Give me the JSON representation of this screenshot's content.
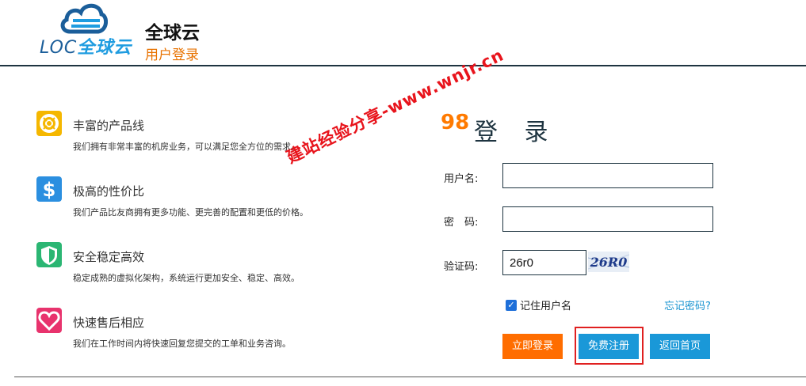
{
  "header": {
    "logo_loc": "LOC",
    "logo_cn": "全球云",
    "site_title": "全球云",
    "site_subtitle": "用户登录"
  },
  "features": [
    {
      "title": "丰富的产品线",
      "desc": "我们拥有非常丰富的机房业务，可以满足您全方位的需求。",
      "icon": "lifebuoy-icon",
      "color": "#f5b700"
    },
    {
      "title": "极高的性价比",
      "desc": "我们产品比友商拥有更多功能、更完善的配置和更低的价格。",
      "icon": "dollar-icon",
      "color": "#2b8fe0"
    },
    {
      "title": "安全稳定高效",
      "desc": "稳定成熟的虚拟化架构，系统运行更加安全、稳定、高效。",
      "icon": "shield-icon",
      "color": "#2bb673"
    },
    {
      "title": "快速售后相应",
      "desc": "我们在工作时间内将快速回复您提交的工单和业务咨询。",
      "icon": "heart-icon",
      "color": "#e8336d"
    }
  ],
  "watermark": {
    "text": "建站经验分享-www.wnjr.cn",
    "prefix": "98"
  },
  "login": {
    "title": "登 录",
    "username_label": "用户名:",
    "username_value": "",
    "password_label": "密　码:",
    "password_value": "",
    "captcha_label": "验证码:",
    "captcha_value": "26r0",
    "captcha_image_text": "26R0",
    "remember_label": "记住用户名",
    "remember_checked": true,
    "forgot_label": "忘记密码?",
    "login_button": "立即登录",
    "register_button": "免费注册",
    "home_button": "返回首页"
  }
}
